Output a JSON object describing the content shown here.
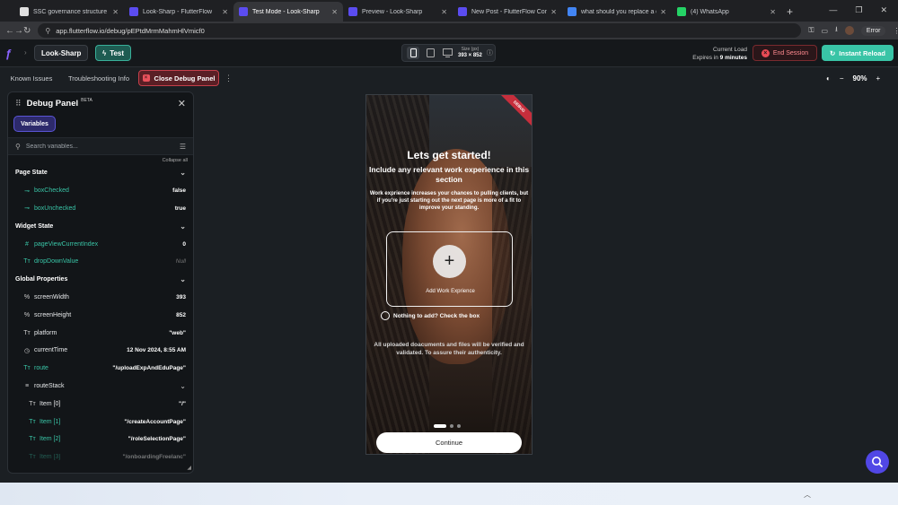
{
  "browser": {
    "tabs": [
      {
        "title": "SSC governance structure unde",
        "fav": "#e0e0e0",
        "active": false
      },
      {
        "title": "Look-Sharp - FlutterFlow",
        "fav": "#5b4cf0",
        "active": false
      },
      {
        "title": "Test Mode - Look-Sharp",
        "fav": "#5b4cf0",
        "active": true
      },
      {
        "title": "Preview - Look-Sharp",
        "fav": "#5b4cf0",
        "active": false
      },
      {
        "title": "New Post - FlutterFlow Commu",
        "fav": "#5b4cf0",
        "active": false
      },
      {
        "title": "what should you replace a date",
        "fav": "#4285f4",
        "active": false
      },
      {
        "title": "(4) WhatsApp",
        "fav": "#25d366",
        "active": false
      }
    ],
    "url": "app.flutterflow.io/debug/pEPtdMrmMahmHlVmicf0",
    "error_label": "Error"
  },
  "topbar": {
    "project": "Look-Sharp",
    "test_label": "Test",
    "size_label": "Size (px)",
    "size_value": "393 × 852",
    "current_load": "Current Load",
    "expires_prefix": "Expires in ",
    "expires_value": "9 minutes",
    "end_session": "End Session",
    "instant_reload": "Instant Reload"
  },
  "toolbar": {
    "known_issues": "Known Issues",
    "troubleshooting": "Troubleshooting Info",
    "close_debug": "Close Debug Panel",
    "zoom": "90%"
  },
  "debug_panel": {
    "title": "Debug Panel",
    "beta": "BETA",
    "variables_tab": "Variables",
    "search_placeholder": "Search variables...",
    "collapse_all": "Collapse all",
    "sections": {
      "page_state": "Page State",
      "widget_state": "Widget State",
      "global_properties": "Global Properties"
    },
    "rows": {
      "boxChecked": {
        "name": "boxChecked",
        "value": "false"
      },
      "boxUnchecked": {
        "name": "boxUnchecked",
        "value": "true"
      },
      "pageViewCurrentIndex": {
        "name": "pageViewCurrentIndex",
        "value": "0"
      },
      "dropDownValue": {
        "name": "dropDownValue",
        "value": "Null"
      },
      "screenWidth": {
        "name": "screenWidth",
        "value": "393"
      },
      "screenHeight": {
        "name": "screenHeight",
        "value": "852"
      },
      "platform": {
        "name": "platform",
        "value": "\"web\""
      },
      "currentTime": {
        "name": "currentTime",
        "value": "12 Nov 2024, 8:55 AM"
      },
      "route": {
        "name": "route",
        "value": "\"/uploadExpAndEduPage\""
      },
      "routeStack": {
        "name": "routeStack"
      },
      "item0": {
        "name": "Item [0]",
        "value": "\"/\""
      },
      "item1": {
        "name": "Item [1]",
        "value": "\"/createAccountPage\""
      },
      "item2": {
        "name": "Item [2]",
        "value": "\"/roleSelectionPage\""
      },
      "item3": {
        "name": "Item [3]",
        "value": "\"/onboardingFreelanc\""
      }
    }
  },
  "app": {
    "debug_flag": "DEBUG",
    "heading": "Lets get started!",
    "subheading": "Include any relevant work experience in this section",
    "body": "Work exprience increases your chances to pulling clients, but if you're just starting out the next page is more of a fit to improve your standing.",
    "add_label": "Add Work Exprience",
    "checkbox_label": "Nothing to add? Check the box",
    "notice": "All uploaded doacuments and files will be verified and validated. To assure their authenticity.",
    "continue": "Continue"
  }
}
